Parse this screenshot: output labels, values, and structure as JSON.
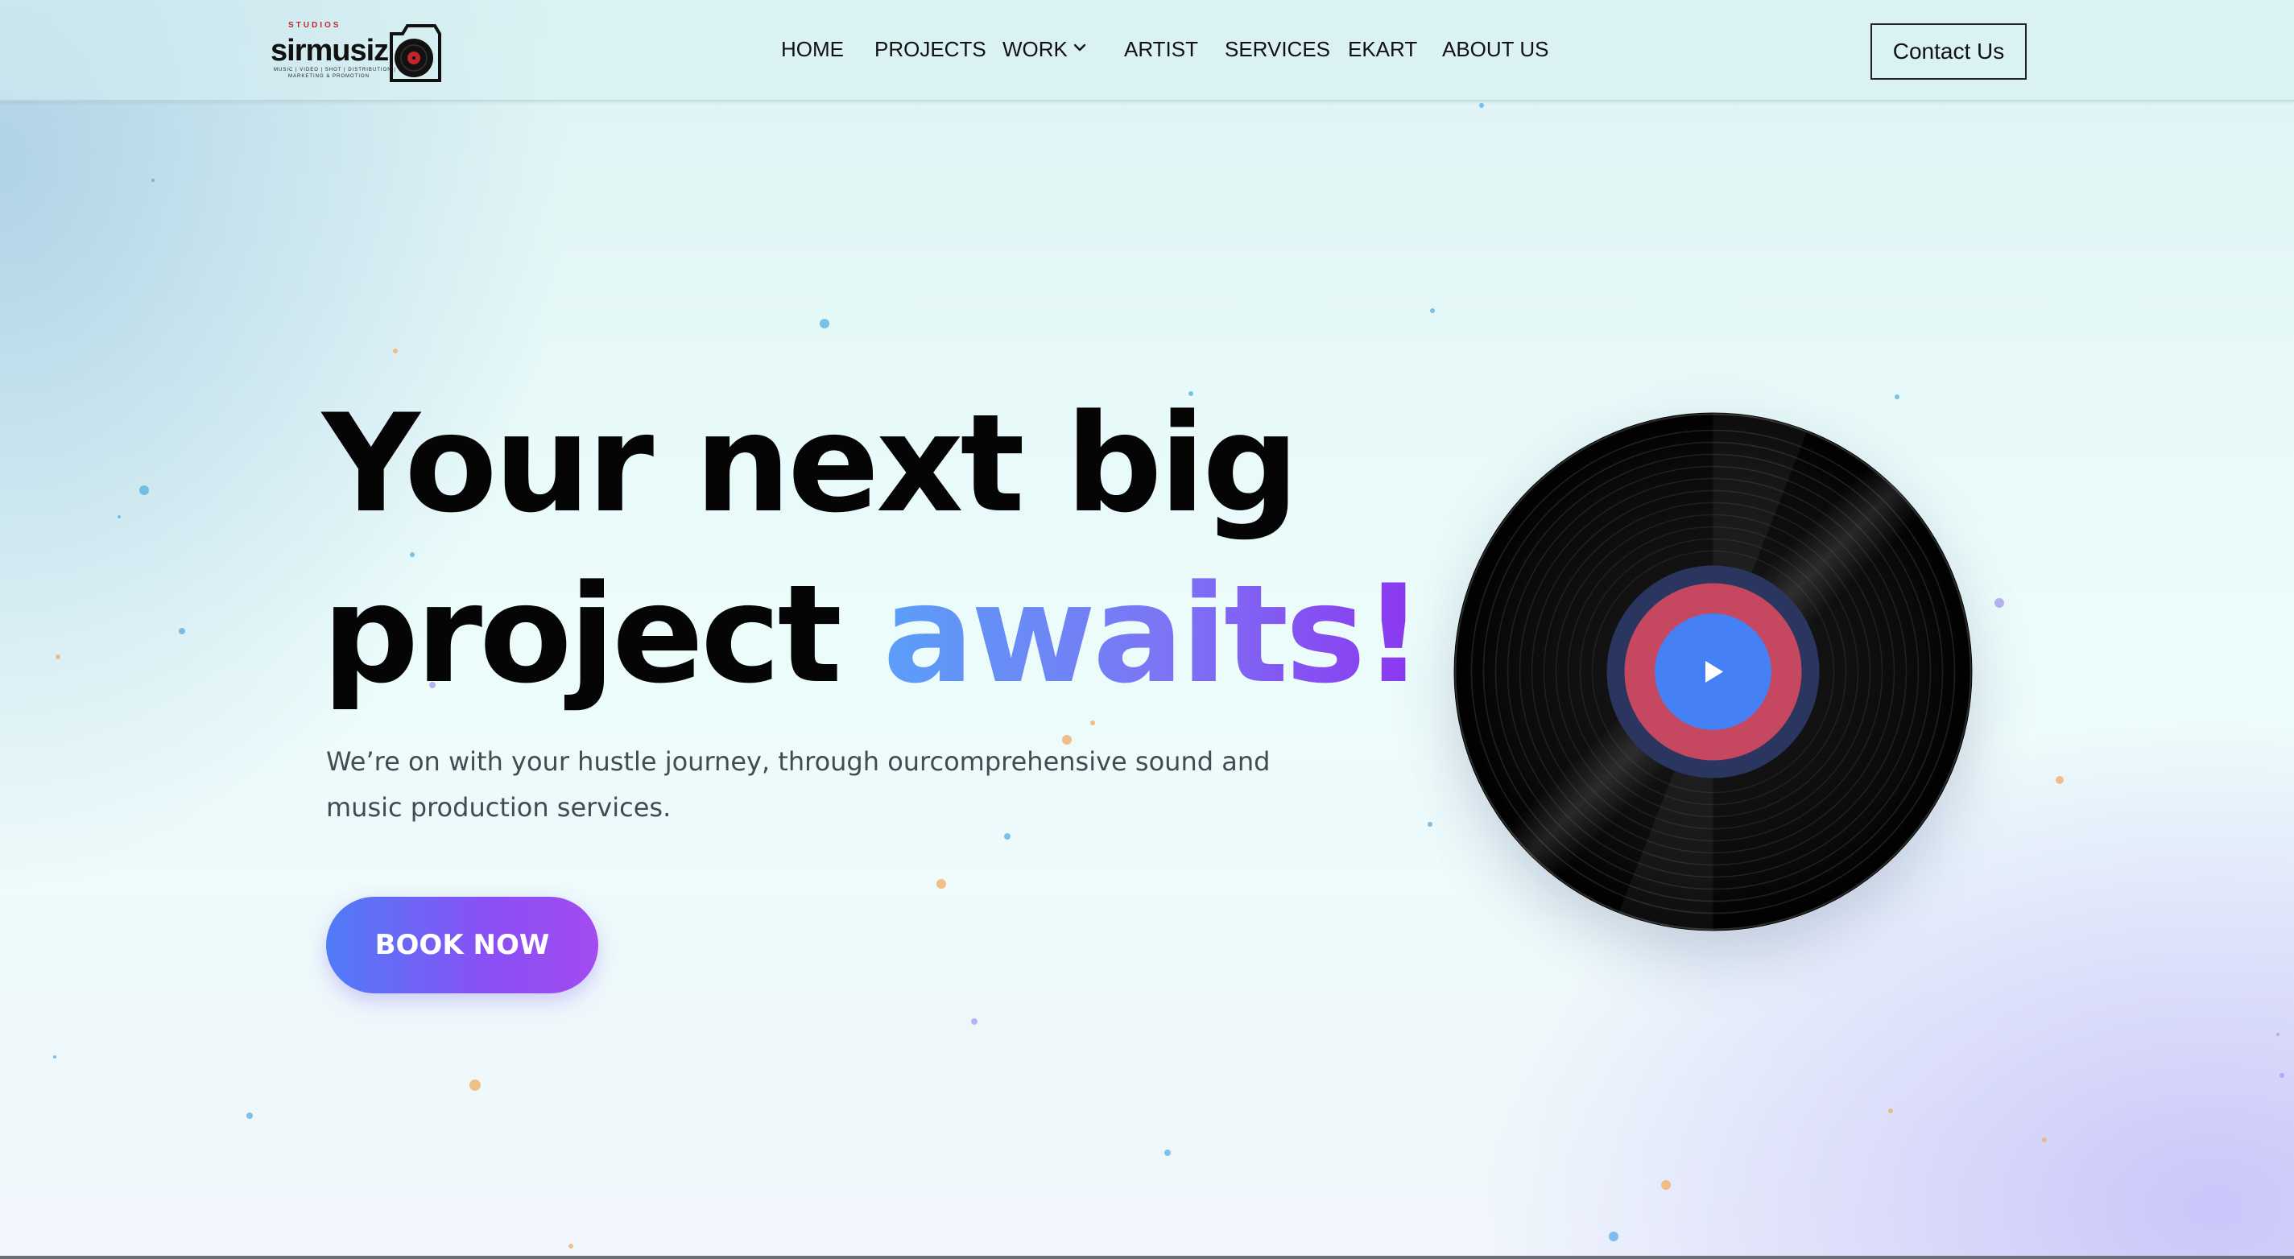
{
  "brand": {
    "name": "sirmusiz",
    "studios_label": "STUDIOS",
    "tagline_line1": "MUSIC | VIDEO | SHOT | DISTRIBUTION |",
    "tagline_line2": "MARKETING & PROMOTION",
    "icon": "vinyl-camera-logo"
  },
  "nav": {
    "items": [
      {
        "label": "HOME"
      },
      {
        "label": "PROJECTS"
      },
      {
        "label": "WORK",
        "icon": "chevron-down-icon"
      },
      {
        "label": "ARTIST"
      },
      {
        "label": "SERVICES"
      },
      {
        "label": "EKART"
      },
      {
        "label": "ABOUT US"
      }
    ]
  },
  "header": {
    "contact_label": "Contact Us"
  },
  "hero": {
    "title_line1": "Your next big",
    "title_line2_plain": "project ",
    "title_line2_accent": "awaits!",
    "subtitle": "We’re on with your hustle journey, through ourcomprehensive sound and music production services.",
    "cta_label": "BOOK NOW"
  },
  "media": {
    "disc_icon": "vinyl-record",
    "play_icon": "play-icon"
  },
  "colors": {
    "accent_start": "#5a9ff8",
    "accent_end": "#8c35f0",
    "button_start": "#4f7cf7",
    "button_end": "#a24bf0",
    "label_red": "#c54860",
    "label_navy": "#2a3560",
    "play_blue": "#4580f5"
  }
}
